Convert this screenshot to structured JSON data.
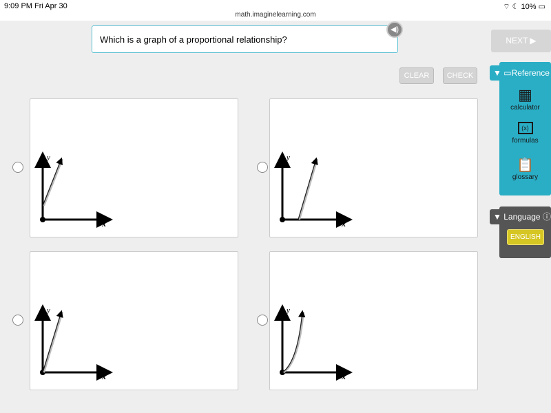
{
  "status": {
    "time": "9:09 PM  Fri Apr 30",
    "url": "math.imaginelearning.com",
    "battery": "10%"
  },
  "question": "Which is a graph of a proportional relationship?",
  "buttons": {
    "clear": "CLEAR",
    "check": "CHECK",
    "next": "NEXT ▶"
  },
  "axes": {
    "x": "x",
    "y": "y"
  },
  "reference": {
    "title": "Reference",
    "items": [
      {
        "label": "calculator",
        "icon": "calculator-icon"
      },
      {
        "label": "formulas",
        "icon": "formulas-icon"
      },
      {
        "label": "glossary",
        "icon": "clipboard-icon"
      }
    ]
  },
  "language": {
    "title": "Language",
    "selected": "ENGLISH"
  },
  "colors": {
    "accent": "#2aaec6",
    "language_button": "#d6c623"
  }
}
